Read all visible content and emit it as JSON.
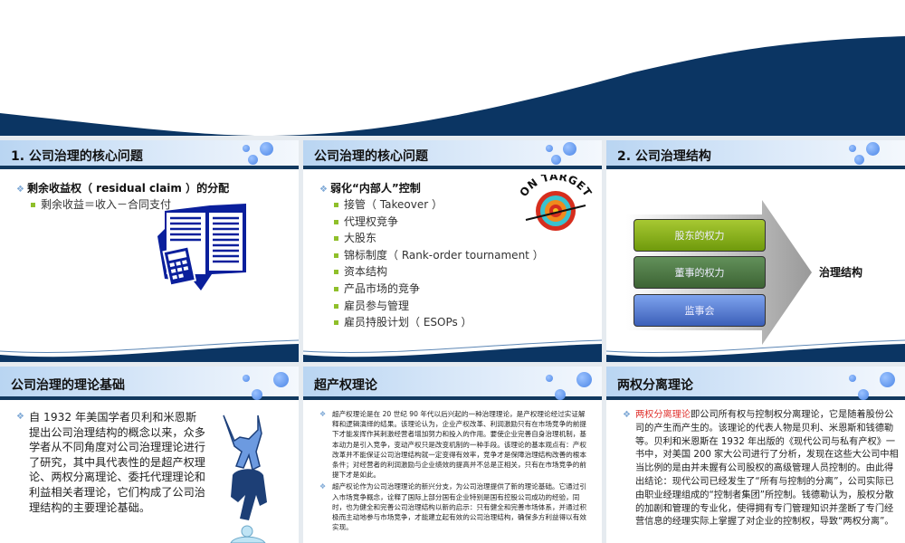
{
  "slides": [
    {
      "title": "1. 公司治理的核心问题",
      "bullet": "剩余收益权（ residual claim ）的分配",
      "sub": [
        "剩余收益＝收入－合同支付"
      ],
      "icon": "ledger-calculator-icon"
    },
    {
      "title": "公司治理的核心问题",
      "bullet": "弱化“内部人”控制",
      "sub": [
        "接管（ Takeover ）",
        "代理权竞争",
        "大股东",
        "锦标制度（ Rank-order tournament ）",
        "资本结构",
        "产品市场的竞争",
        "雇员参与管理",
        "雇员持股计划（  ESOPs ）"
      ],
      "badge": "ON TARGET"
    },
    {
      "title": "2. 公司治理结构",
      "boxes": [
        "股东的权力",
        "董事的权力",
        "监事会"
      ],
      "result": "治理结构"
    },
    {
      "title": "公司治理的理论基础",
      "text": "自 1932 年美国学者贝利和米恩斯提出公司治理结构的概念以来，众多学者从不同角度对公司治理理论进行了研究，其中具代表性的是超产权理论、两权分离理论、委托代理理论和利益相关者理论，它们构成了公司治理结构的主要理论基础。"
    },
    {
      "title": "超产权理论",
      "paras": [
        "超产权理论是在 20 世纪 90 年代以后兴起的一种治理理论，是产权理论经过实证解释和逻辑演绎的结果。该理论认为，企业产权改革、利润激励只有在市场竞争的前提下才能发挥作其刺激经营者增加努力和投入的作用。要使企业完善自身治理机制，基本动力是引入竞争，变动产权只是改变机制的一种手段。该理论的基本观点有：产权改革并不能保证公司治理结构就一定变得有效率，竞争才是保障治理结构改善的根本条件；对经营者的利润激励与企业绩效的提高并不总是正相关，只有在市场竞争的前提下才是如此。",
        "超产权论作为公司治理理论的新兴分支，为公司治理提供了新的理论基础。它通过引入市场竞争概念，诠释了国际上部分国有企业特别是国有控股公司成功的经验，同时，也为健全和完善公司治理结构以新的启示：只有健全和完善市场体系，并通过积极而主动地参与市场竞争，才能建立起有效的公司治理结构，确保多方利益得以有效实现。"
      ]
    },
    {
      "title": "两权分离理论",
      "highlight": "两权分离理论",
      "text": "即公司所有权与控制权分离理论，它是随着股份公司的产生而产生的。该理论的代表人物是贝利、米恩斯和钱德勒等。贝利和米恩斯在 1932 年出版的《现代公司与私有产权》一书中，对美国 200 家大公司进行了分析，发现在这些大公司中相当比例的是由并未握有公司股权的高级管理人员控制的。由此得出结论：现代公司已经发生了“所有与控制的分离”，公司实际已由职业经理组成的“控制者集团”所控制。钱德勒认为，股权分散的加剧和管理的专业化，使得拥有专门管理知识并垄断了专门经营信息的经理实际上掌握了对企业的控制权，导致“两权分离”。"
    }
  ],
  "colors": {
    "navy": "#0b3563",
    "green": "#86b31a",
    "darkgreen": "#4d7a3f",
    "blue": "#4f79c9",
    "highlight": "#e0322e"
  }
}
